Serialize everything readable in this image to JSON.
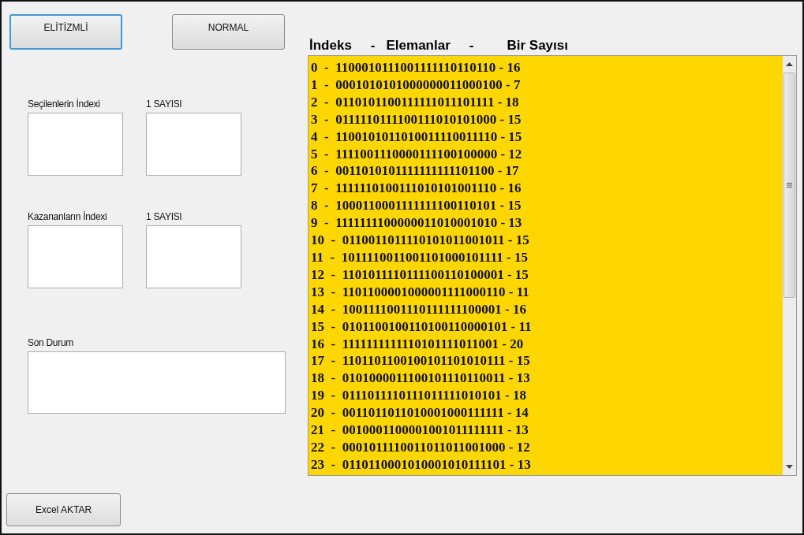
{
  "buttons": [
    {
      "label": "ELİTİZMLİ",
      "focused": true
    },
    {
      "label": "NORMAL",
      "focused": false
    }
  ],
  "fields": [
    {
      "label": "Seçilenlerin İndexi",
      "kind": "small"
    },
    {
      "label": "1 SAYISI",
      "kind": "small"
    },
    {
      "label": "Kazananların İndexi",
      "kind": "small"
    },
    {
      "label": "1 SAYISI",
      "kind": "small"
    },
    {
      "label": "Son Durum",
      "kind": "wide"
    }
  ],
  "export_button": {
    "label": "Excel AKTAR"
  },
  "list_header": [
    "İndeks",
    "-",
    "Elemanlar",
    "-",
    "Bir Sayısı"
  ],
  "list_items": [
    "0  -  1100010111001111110110110 - 16",
    "1  -  0001010101000000011000100 - 7",
    "2  -  0110101100111111011101111 - 18",
    "3  -  0111110111100111010101000 - 15",
    "4  -  1100101011010011110011110 - 15",
    "5  -  1111001110000111100100000 - 12",
    "6  -  0011010101111111111101100 - 17",
    "7  -  1111110100111010101001110 - 16",
    "8  -  1000110001111111100110101 - 15",
    "9  -  1111111100000011010001010 - 13",
    "10  -  0110011011110101011001011 - 15",
    "11  -  1011110011001101000101111 - 15",
    "12  -  1101011110111100110100001 - 15",
    "13  -  1101100001000001111000110 - 11",
    "14  -  1001111001110111111100001 - 16",
    "15  -  0101100100110100110000101 - 11",
    "16  -  1111111111110101111011001 - 20",
    "17  -  1101101100100101101010111 - 15",
    "18  -  0101000011100101110110011 - 13",
    "19  -  0111011110111011111010101 - 18",
    "20  -  0011011011010001000111111 - 14",
    "21  -  0010001100001001011111111 - 13",
    "22  -  0001011110011011011001000 - 12",
    "23  -  0110110001010001010111101 - 13"
  ]
}
